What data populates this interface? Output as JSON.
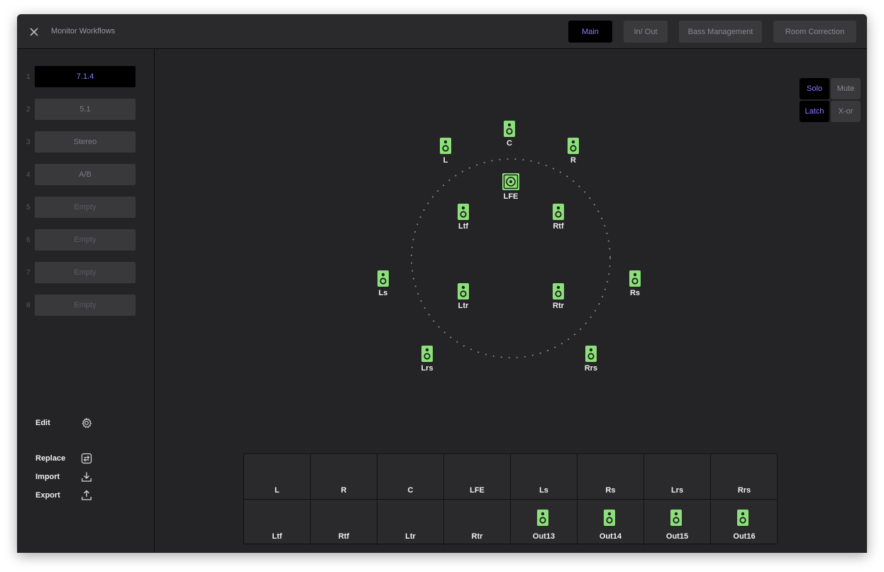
{
  "window": {
    "title": "Monitor Workflows"
  },
  "tabs": [
    "Main",
    "In/ Out",
    "Bass Management",
    "Room Correction"
  ],
  "active_tab": "Main",
  "slots": [
    {
      "num": "1",
      "label": "7.1.4",
      "state": "active"
    },
    {
      "num": "2",
      "label": "5.1",
      "state": "normal"
    },
    {
      "num": "3",
      "label": "Stereo",
      "state": "normal"
    },
    {
      "num": "4",
      "label": "A/B",
      "state": "normal"
    },
    {
      "num": "5",
      "label": "Empty",
      "state": "empty"
    },
    {
      "num": "6",
      "label": "Empty",
      "state": "empty"
    },
    {
      "num": "7",
      "label": "Empty",
      "state": "empty"
    },
    {
      "num": "8",
      "label": "Empty",
      "state": "empty"
    }
  ],
  "actions": {
    "edit": "Edit",
    "replace": "Replace",
    "import": "Import",
    "export": "Export"
  },
  "monitor_buttons": {
    "solo": "Solo",
    "mute": "Mute",
    "latch": "Latch",
    "xor": "X-or"
  },
  "speakers": [
    "C",
    "L",
    "R",
    "LFE",
    "Ltf",
    "Rtf",
    "Ls",
    "Rs",
    "Ltr",
    "Rtr",
    "Lrs",
    "Rrs"
  ],
  "grid": {
    "row1": [
      "L",
      "R",
      "C",
      "LFE",
      "Ls",
      "Rs",
      "Lrs",
      "Rrs"
    ],
    "row2": [
      "Ltf",
      "Rtf",
      "Ltr",
      "Rtr",
      "Out13",
      "Out14",
      "Out15",
      "Out16"
    ]
  },
  "colors": {
    "speaker_green": "#8ce07a",
    "accent": "#8a7cff",
    "background": "#242426"
  },
  "icons": {
    "close": "close-icon",
    "gear": "gear-icon",
    "replace": "replace-icon",
    "import": "download-icon",
    "export": "upload-icon",
    "speaker": "speaker-icon",
    "subwoofer": "subwoofer-icon"
  }
}
